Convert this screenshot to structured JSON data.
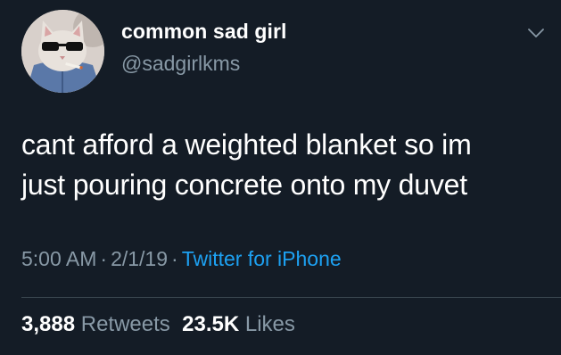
{
  "tweet": {
    "display_name": "common sad girl",
    "handle": "@sadgirlkms",
    "text_lines": [
      "cant afford a weighted blanket so im",
      "just pouring concrete onto my duvet"
    ],
    "time": "5:00 AM",
    "separator": "·",
    "date": "2/1/19",
    "source": "Twitter for iPhone",
    "retweets_count": "3,888",
    "retweets_label": "Retweets",
    "likes_count": "23.5K",
    "likes_label": "Likes"
  },
  "icons": {
    "avatar": "cat-with-sunglasses-avatar",
    "menu": "chevron-down-icon"
  },
  "colors": {
    "background": "#141c26",
    "primary_text": "#ffffff",
    "secondary_text": "#8899a6",
    "link": "#1da1f2",
    "divider": "#38444d"
  }
}
